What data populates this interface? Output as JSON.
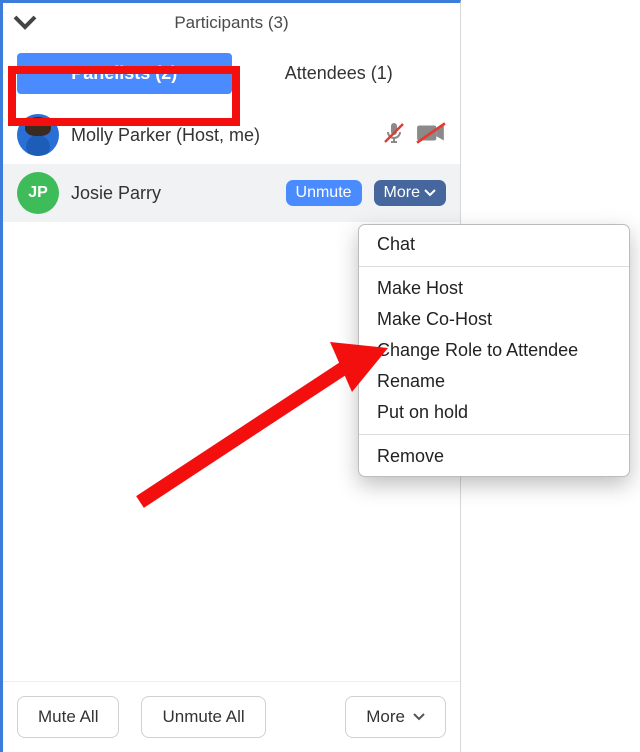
{
  "header": {
    "title": "Participants (3)"
  },
  "tabs": {
    "panelists": "Panelists (2)",
    "attendees": "Attendees (1)"
  },
  "participants": {
    "host": {
      "name": "Molly Parker (Host, me)"
    },
    "panelist": {
      "initials": "JP",
      "name": "Josie Parry",
      "unmute_label": "Unmute",
      "more_label": "More"
    }
  },
  "menu": {
    "chat": "Chat",
    "make_host": "Make Host",
    "make_cohost": "Make Co-Host",
    "change_role": "Change Role to Attendee",
    "rename": "Rename",
    "hold": "Put on hold",
    "remove": "Remove"
  },
  "footer": {
    "mute_all": "Mute All",
    "unmute_all": "Unmute All",
    "more": "More"
  }
}
